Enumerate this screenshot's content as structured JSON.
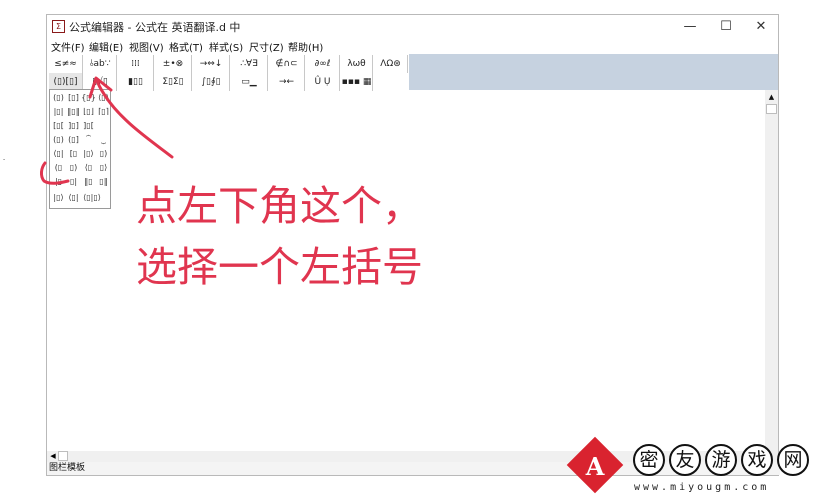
{
  "window": {
    "app_icon": "equation-editor-icon",
    "title": "公式编辑器 - 公式在 英语翻译.d 中",
    "controls": {
      "minimize": "—",
      "maximize": "☐",
      "close": "✕"
    }
  },
  "menu": [
    "文件(F)",
    "编辑(E)",
    "视图(V)",
    "格式(T)",
    "样式(S)",
    "尺寸(Z)",
    "帮助(H)"
  ],
  "toolbar_row1": [
    "≤≠≈",
    "⫰ab∵",
    "⁞⁞⁞",
    "±•⊗",
    "→⇔↓",
    "∴∀∃",
    "∉∩⊂",
    "∂∞ℓ",
    "λωθ",
    "ΛΩ⊛"
  ],
  "toolbar_row2": [
    "(▯)[▯]",
    "▯√▯",
    "▮▯▯",
    "Σ▯Σ▯",
    "∫▯∮▯",
    "▭▁",
    "→←",
    "Û Ụ",
    "▪▪▪ ▦"
  ],
  "palette": {
    "rows": [
      [
        "(▯)",
        "[▯]",
        "{▯}",
        "⟨▯⟩"
      ],
      [
        "|▯|",
        "‖▯‖",
        "⌊▯⌋",
        "⌈▯⌉"
      ],
      [
        "[▯[",
        "]▯]",
        "]▯[",
        ""
      ],
      [
        "(▯)",
        "(▯]",
        "⏞",
        "⏟"
      ],
      [
        "⟨▯|",
        "[▯",
        "|▯⟩",
        "▯)"
      ],
      [
        "(▯",
        "▯)",
        "⟨▯",
        "▯⟩"
      ],
      [
        "|▯",
        "▯|",
        "‖▯",
        "▯‖"
      ],
      [
        "|▯⟩",
        "⟨▯|",
        "⟨▯|▯⟩",
        ""
      ]
    ]
  },
  "status_text": "图栏模板",
  "annotation": {
    "line1": "点左下角这个，",
    "line2": "选择一个左括号",
    "color": "#e0354f"
  },
  "watermark": {
    "mark": "A",
    "chars": [
      "密",
      "友",
      "游",
      "戏",
      "网"
    ],
    "url": "www.miyougm.com",
    "brand_color": "#d9232f"
  },
  "stray_mark": "-"
}
